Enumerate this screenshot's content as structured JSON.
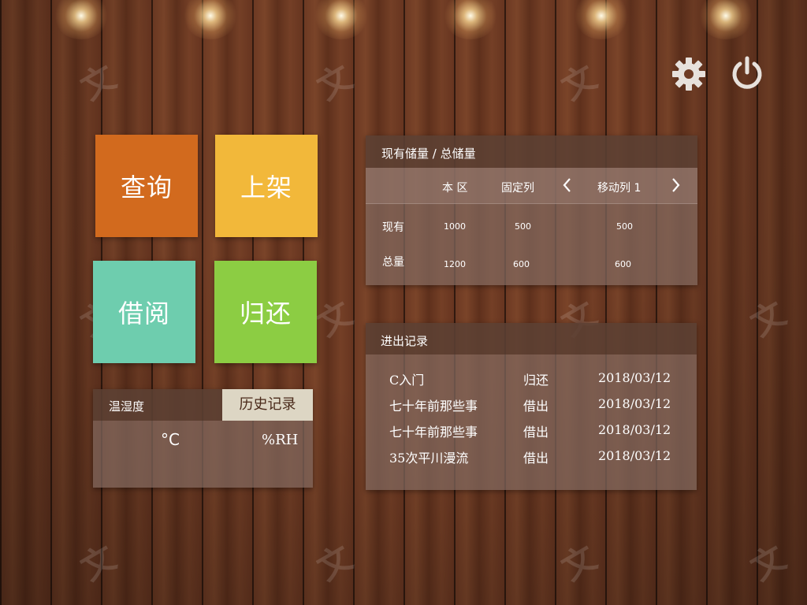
{
  "tiles": {
    "query": {
      "label": "查询",
      "color": "#d26a1e"
    },
    "shelve": {
      "label": "上架",
      "color": "#f2b83a"
    },
    "borrow": {
      "label": "借阅",
      "color": "#6ecdae"
    },
    "return": {
      "label": "归还",
      "color": "#8ccd43"
    }
  },
  "top_icons": {
    "settings": "gear-icon",
    "power": "power-icon"
  },
  "watermark_text": "文",
  "storage": {
    "title": "现有储量 / 总储量",
    "columns": {
      "zone": "本 区",
      "fixed": "固定列",
      "mobile": "移动列 1"
    },
    "rows": [
      {
        "label": "现有",
        "zone": "1000",
        "fixed": "500",
        "mobile": "500"
      },
      {
        "label": "总量",
        "zone": "1200",
        "fixed": "600",
        "mobile": "600"
      }
    ]
  },
  "climate": {
    "title": "温湿度",
    "history_button": "历史记录",
    "temp_unit": "°C",
    "humidity_unit": "%RH"
  },
  "records": {
    "title": "进出记录",
    "items": [
      {
        "name": "C入门",
        "action": "归还",
        "date": "2018/03/12"
      },
      {
        "name": "七十年前那些事",
        "action": "借出",
        "date": "2018/03/12"
      },
      {
        "name": "七十年前那些事",
        "action": "借出",
        "date": "2018/03/12"
      },
      {
        "name": "35次平川漫流",
        "action": "借出",
        "date": "2018/03/12"
      }
    ]
  }
}
